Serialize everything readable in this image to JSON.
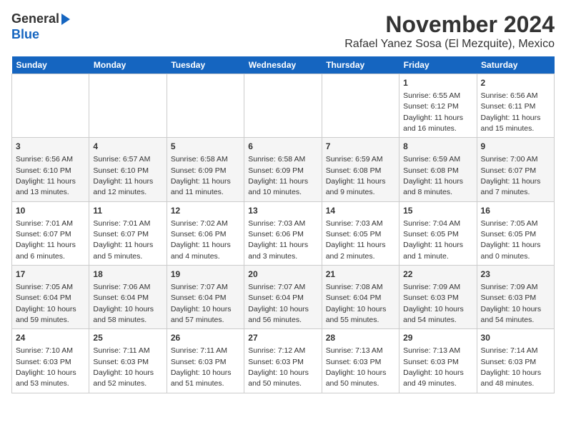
{
  "header": {
    "logo_line1": "General",
    "logo_line2": "Blue",
    "title": "November 2024",
    "subtitle": "Rafael Yanez Sosa (El Mezquite), Mexico"
  },
  "days_of_week": [
    "Sunday",
    "Monday",
    "Tuesday",
    "Wednesday",
    "Thursday",
    "Friday",
    "Saturday"
  ],
  "weeks": [
    [
      {
        "day": null,
        "text": null
      },
      {
        "day": null,
        "text": null
      },
      {
        "day": null,
        "text": null
      },
      {
        "day": null,
        "text": null
      },
      {
        "day": null,
        "text": null
      },
      {
        "day": "1",
        "text": "Sunrise: 6:55 AM\nSunset: 6:12 PM\nDaylight: 11 hours\nand 16 minutes."
      },
      {
        "day": "2",
        "text": "Sunrise: 6:56 AM\nSunset: 6:11 PM\nDaylight: 11 hours\nand 15 minutes."
      }
    ],
    [
      {
        "day": "3",
        "text": "Sunrise: 6:56 AM\nSunset: 6:10 PM\nDaylight: 11 hours\nand 13 minutes."
      },
      {
        "day": "4",
        "text": "Sunrise: 6:57 AM\nSunset: 6:10 PM\nDaylight: 11 hours\nand 12 minutes."
      },
      {
        "day": "5",
        "text": "Sunrise: 6:58 AM\nSunset: 6:09 PM\nDaylight: 11 hours\nand 11 minutes."
      },
      {
        "day": "6",
        "text": "Sunrise: 6:58 AM\nSunset: 6:09 PM\nDaylight: 11 hours\nand 10 minutes."
      },
      {
        "day": "7",
        "text": "Sunrise: 6:59 AM\nSunset: 6:08 PM\nDaylight: 11 hours\nand 9 minutes."
      },
      {
        "day": "8",
        "text": "Sunrise: 6:59 AM\nSunset: 6:08 PM\nDaylight: 11 hours\nand 8 minutes."
      },
      {
        "day": "9",
        "text": "Sunrise: 7:00 AM\nSunset: 6:07 PM\nDaylight: 11 hours\nand 7 minutes."
      }
    ],
    [
      {
        "day": "10",
        "text": "Sunrise: 7:01 AM\nSunset: 6:07 PM\nDaylight: 11 hours\nand 6 minutes."
      },
      {
        "day": "11",
        "text": "Sunrise: 7:01 AM\nSunset: 6:07 PM\nDaylight: 11 hours\nand 5 minutes."
      },
      {
        "day": "12",
        "text": "Sunrise: 7:02 AM\nSunset: 6:06 PM\nDaylight: 11 hours\nand 4 minutes."
      },
      {
        "day": "13",
        "text": "Sunrise: 7:03 AM\nSunset: 6:06 PM\nDaylight: 11 hours\nand 3 minutes."
      },
      {
        "day": "14",
        "text": "Sunrise: 7:03 AM\nSunset: 6:05 PM\nDaylight: 11 hours\nand 2 minutes."
      },
      {
        "day": "15",
        "text": "Sunrise: 7:04 AM\nSunset: 6:05 PM\nDaylight: 11 hours\nand 1 minute."
      },
      {
        "day": "16",
        "text": "Sunrise: 7:05 AM\nSunset: 6:05 PM\nDaylight: 11 hours\nand 0 minutes."
      }
    ],
    [
      {
        "day": "17",
        "text": "Sunrise: 7:05 AM\nSunset: 6:04 PM\nDaylight: 10 hours\nand 59 minutes."
      },
      {
        "day": "18",
        "text": "Sunrise: 7:06 AM\nSunset: 6:04 PM\nDaylight: 10 hours\nand 58 minutes."
      },
      {
        "day": "19",
        "text": "Sunrise: 7:07 AM\nSunset: 6:04 PM\nDaylight: 10 hours\nand 57 minutes."
      },
      {
        "day": "20",
        "text": "Sunrise: 7:07 AM\nSunset: 6:04 PM\nDaylight: 10 hours\nand 56 minutes."
      },
      {
        "day": "21",
        "text": "Sunrise: 7:08 AM\nSunset: 6:04 PM\nDaylight: 10 hours\nand 55 minutes."
      },
      {
        "day": "22",
        "text": "Sunrise: 7:09 AM\nSunset: 6:03 PM\nDaylight: 10 hours\nand 54 minutes."
      },
      {
        "day": "23",
        "text": "Sunrise: 7:09 AM\nSunset: 6:03 PM\nDaylight: 10 hours\nand 54 minutes."
      }
    ],
    [
      {
        "day": "24",
        "text": "Sunrise: 7:10 AM\nSunset: 6:03 PM\nDaylight: 10 hours\nand 53 minutes."
      },
      {
        "day": "25",
        "text": "Sunrise: 7:11 AM\nSunset: 6:03 PM\nDaylight: 10 hours\nand 52 minutes."
      },
      {
        "day": "26",
        "text": "Sunrise: 7:11 AM\nSunset: 6:03 PM\nDaylight: 10 hours\nand 51 minutes."
      },
      {
        "day": "27",
        "text": "Sunrise: 7:12 AM\nSunset: 6:03 PM\nDaylight: 10 hours\nand 50 minutes."
      },
      {
        "day": "28",
        "text": "Sunrise: 7:13 AM\nSunset: 6:03 PM\nDaylight: 10 hours\nand 50 minutes."
      },
      {
        "day": "29",
        "text": "Sunrise: 7:13 AM\nSunset: 6:03 PM\nDaylight: 10 hours\nand 49 minutes."
      },
      {
        "day": "30",
        "text": "Sunrise: 7:14 AM\nSunset: 6:03 PM\nDaylight: 10 hours\nand 48 minutes."
      }
    ]
  ]
}
